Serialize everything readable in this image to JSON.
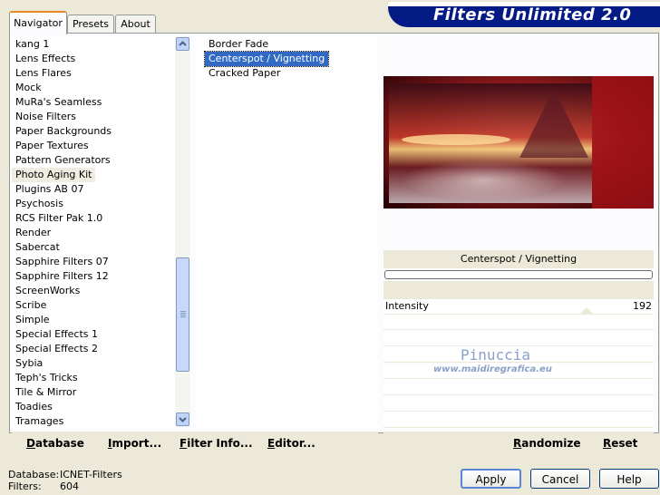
{
  "tabs": [
    {
      "label": "Navigator",
      "active": true
    },
    {
      "label": "Presets",
      "active": false
    },
    {
      "label": "About",
      "active": false
    }
  ],
  "banner": {
    "title": "Filters Unlimited 2.0",
    "color": "#041a84"
  },
  "categories": [
    "kang 1",
    "Lens Effects",
    "Lens Flares",
    "Mock",
    "MuRa's Seamless",
    "Noise Filters",
    "Paper Backgrounds",
    "Paper Textures",
    "Pattern Generators",
    "Photo Aging Kit",
    "Plugins AB 07",
    "Psychosis",
    "RCS Filter Pak 1.0",
    "Render",
    "Sabercat",
    "Sapphire Filters 07",
    "Sapphire Filters 12",
    "ScreenWorks",
    "Scribe",
    "Simple",
    "Special Effects 1",
    "Special Effects 2",
    "Sybia",
    "Teph's Tricks",
    "Tile & Mirror",
    "Toadies",
    "Tramages"
  ],
  "selected_category": "Photo Aging Kit",
  "filters": [
    "Border Fade",
    "Centerspot / Vignetting",
    "Cracked Paper"
  ],
  "selected_filter": "Centerspot / Vignetting",
  "toolbar": {
    "database": "Database",
    "import": "Import...",
    "filter_info": "Filter Info...",
    "editor": "Editor...",
    "randomize": "Randomize",
    "reset": "Reset"
  },
  "filter_panel": {
    "title": "Centerspot / Vignetting",
    "param_label": "Intensity",
    "param_value": "192",
    "param_fraction": 0.753
  },
  "watermark": {
    "name": "Pinuccia",
    "site": "www.maidiregrafica.eu"
  },
  "status": {
    "database_label": "Database:",
    "database_value": "ICNET-Filters",
    "filters_label": "Filters:",
    "filters_value": "604"
  },
  "buttons": {
    "apply": "Apply",
    "cancel": "Cancel",
    "help": "Help"
  }
}
